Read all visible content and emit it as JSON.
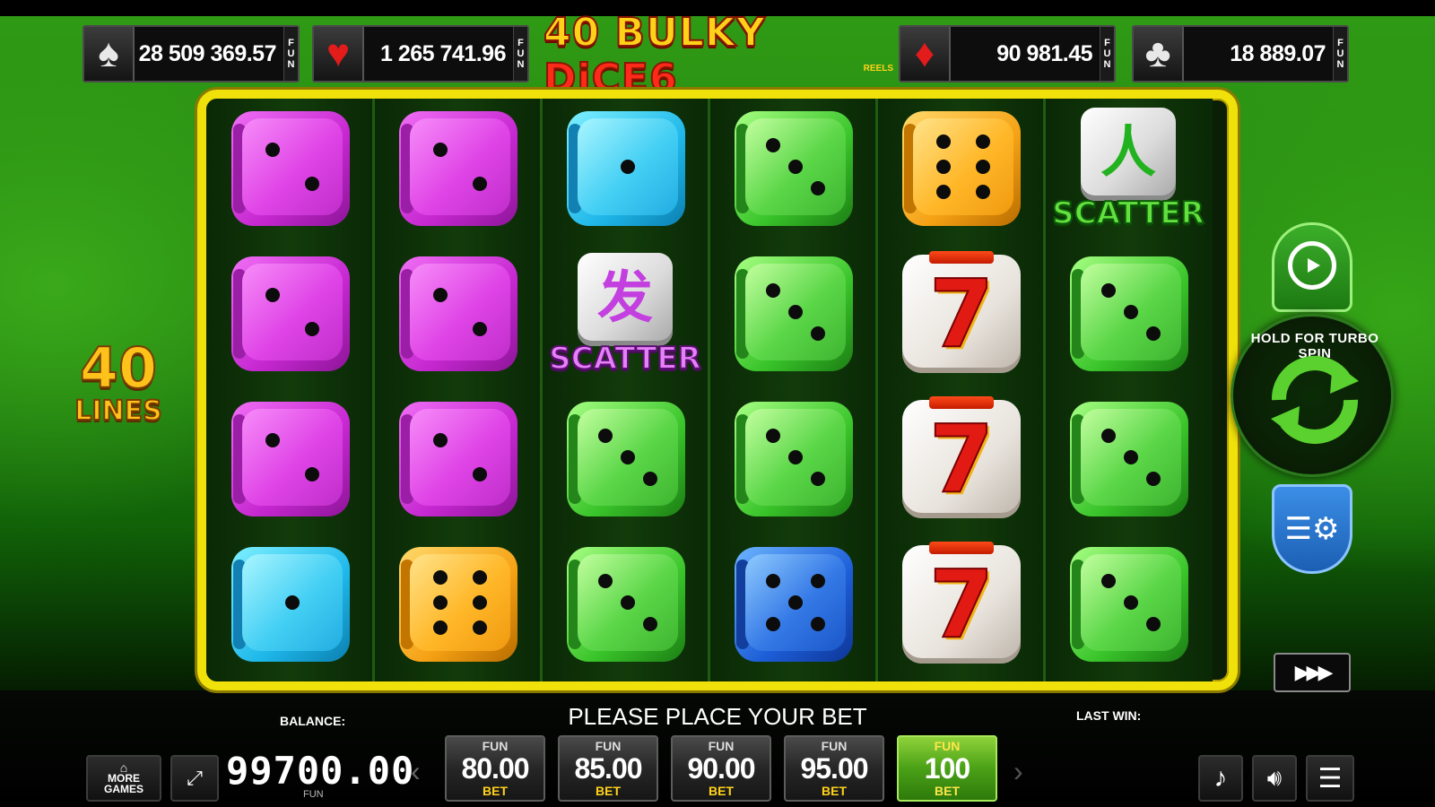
{
  "jackpots": [
    {
      "suit": "♠",
      "suit_name": "spade",
      "value": "28 509 369.57",
      "fun": [
        "F",
        "U",
        "N"
      ],
      "color": "#ffffff"
    },
    {
      "suit": "♥",
      "suit_name": "heart",
      "value": "1 265 741.96",
      "fun": [
        "F",
        "U",
        "N"
      ],
      "color": "#e21b1b"
    },
    {
      "suit": "♦",
      "suit_name": "diamond",
      "value": "90 981.45",
      "fun": [
        "F",
        "U",
        "N"
      ],
      "color": "#e21b1b"
    },
    {
      "suit": "♣",
      "suit_name": "club",
      "value": "18 889.07",
      "fun": [
        "F",
        "U",
        "N"
      ],
      "color": "#ffffff"
    }
  ],
  "logo": {
    "part1": "40 BULKY ",
    "part2": "DiCE",
    "part3": "6",
    "reels": "REELS"
  },
  "lines": {
    "number": "40",
    "word": "LINES"
  },
  "reels": [
    [
      {
        "t": "die",
        "c": "magenta",
        "n": 2
      },
      {
        "t": "die",
        "c": "magenta",
        "n": 2
      },
      {
        "t": "die",
        "c": "magenta",
        "n": 2
      },
      {
        "t": "die",
        "c": "cyan",
        "n": 1
      }
    ],
    [
      {
        "t": "die",
        "c": "magenta",
        "n": 2
      },
      {
        "t": "die",
        "c": "magenta",
        "n": 2
      },
      {
        "t": "die",
        "c": "magenta",
        "n": 2
      },
      {
        "t": "die",
        "c": "orange",
        "n": 6
      }
    ],
    [
      {
        "t": "die",
        "c": "cyan",
        "n": 1
      },
      {
        "t": "scatter",
        "c": "purple"
      },
      {
        "t": "die",
        "c": "green",
        "n": 3
      },
      {
        "t": "die",
        "c": "green",
        "n": 3
      }
    ],
    [
      {
        "t": "die",
        "c": "green",
        "n": 3
      },
      {
        "t": "die",
        "c": "green",
        "n": 3
      },
      {
        "t": "die",
        "c": "green",
        "n": 3
      },
      {
        "t": "die",
        "c": "blue",
        "n": 5
      }
    ],
    [
      {
        "t": "die",
        "c": "orange",
        "n": 6
      },
      {
        "t": "seven"
      },
      {
        "t": "seven"
      },
      {
        "t": "seven"
      }
    ],
    [
      {
        "t": "scatter",
        "c": "greenish"
      },
      {
        "t": "die",
        "c": "green",
        "n": 3
      },
      {
        "t": "die",
        "c": "green",
        "n": 3
      },
      {
        "t": "die",
        "c": "green",
        "n": 3
      }
    ]
  ],
  "symbols": {
    "scatter_word": "SCATTER",
    "seven": "7",
    "glyph_green": "人",
    "glyph_purple": "发"
  },
  "controls": {
    "turbo_text": "HOLD FOR TURBO SPIN",
    "autoplay_icon": "autoplay-icon",
    "settings_icon": "settings-icon",
    "fast_icon": "▶▶▶"
  },
  "info": {
    "balance_label": "BALANCE:",
    "balance_value": "99700.00",
    "balance_currency": "FUN",
    "message": "PLEASE PLACE YOUR BET",
    "last_win_label": "LAST WIN:"
  },
  "buttons": {
    "more_games": [
      "MORE",
      "GAMES"
    ],
    "bets": [
      {
        "fun": "FUN",
        "value": "80.00",
        "bet": "BET",
        "active": false
      },
      {
        "fun": "FUN",
        "value": "85.00",
        "bet": "BET",
        "active": false
      },
      {
        "fun": "FUN",
        "value": "90.00",
        "bet": "BET",
        "active": false
      },
      {
        "fun": "FUN",
        "value": "95.00",
        "bet": "BET",
        "active": false
      },
      {
        "fun": "FUN",
        "value": "100",
        "bet": "BET",
        "active": true
      }
    ]
  }
}
